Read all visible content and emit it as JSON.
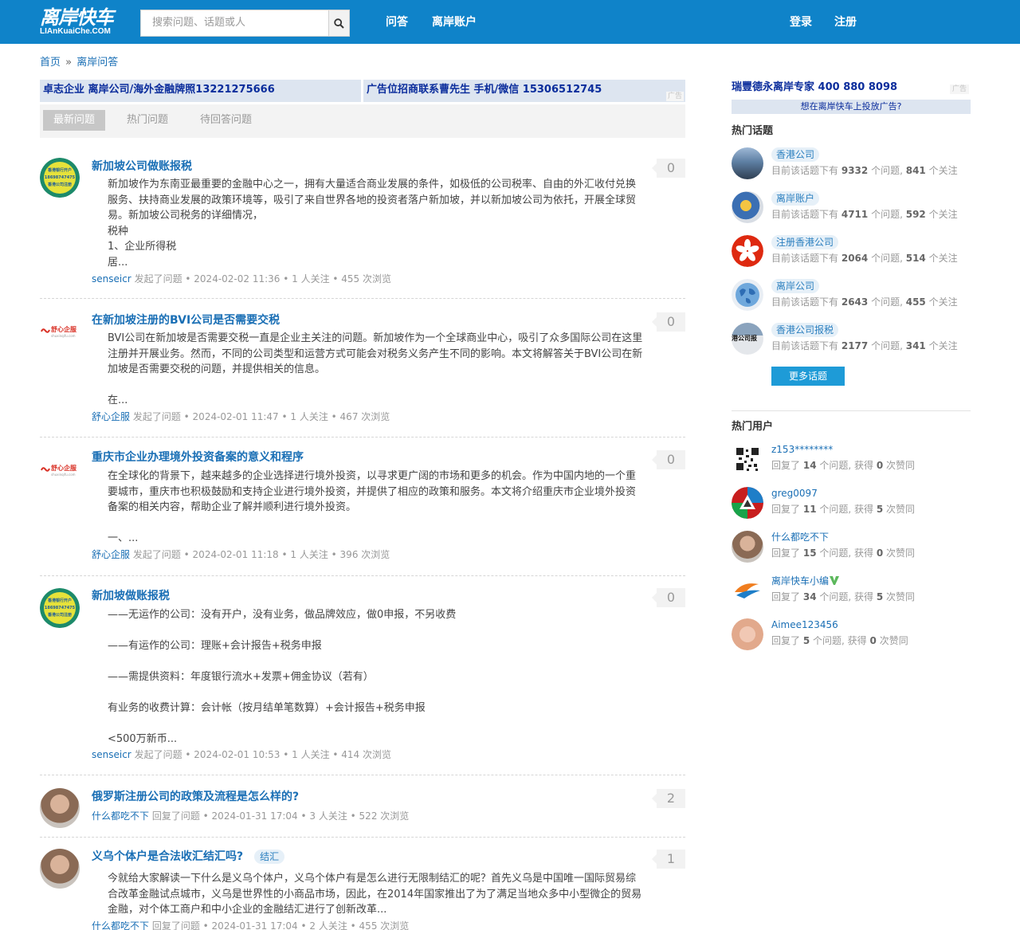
{
  "header": {
    "logo_cn": "离岸快车",
    "logo_en": "LIAnKuaiChe.COM",
    "search_placeholder": "搜索问题、话题或人",
    "nav": [
      "问答",
      "离岸账户"
    ],
    "login": "登录",
    "register": "注册"
  },
  "breadcrumb": {
    "home": "首页",
    "sep": "»",
    "current": "离岸问答"
  },
  "ads": {
    "left": "卓志企业 离岸公司/海外金融牌照13221275666",
    "right": "广告位招商联系曹先生 手机/微信 15306512745",
    "tag": "广告"
  },
  "tabs": [
    "最新问题",
    "热门问题",
    "待回答问题"
  ],
  "questions": [
    {
      "title": "新加坡公司做账报税",
      "count": "0",
      "body": "新加坡作为东南亚最重要的金融中心之一，拥有大量适合商业发展的条件，如极低的公司税率、自由的外汇收付兑换服务、扶持商业发展的政策环境等，吸引了来自世界各地的投资者落户新加坡，并以新加坡公司为依托，开展全球贸易。新加坡公司税务的详细情况，\n税种\n1、企业所得税\n居...",
      "user": "senseicr",
      "meta": "发起了问题 • 2024-02-02 11:36 • 1 人关注 • 455 次浏览"
    },
    {
      "title": "在新加坡注册的BVI公司是否需要交税",
      "count": "0",
      "body": "BVI公司在新加坡是否需要交税一直是企业主关注的问题。新加坡作为一个全球商业中心，吸引了众多国际公司在这里注册并开展业务。然而，不同的公司类型和运营方式可能会对税务义务产生不同的影响。本文将解答关于BVI公司在新加坡是否需要交税的问题，并提供相关的信息。\n\n在...",
      "user": "舒心企服",
      "meta": "发起了问题 • 2024-02-01 11:47 • 1 人关注 • 467 次浏览"
    },
    {
      "title": "重庆市企业办理境外投资备案的意义和程序",
      "count": "0",
      "body": "在全球化的背景下，越来越多的企业选择进行境外投资，以寻求更广阔的市场和更多的机会。作为中国内地的一个重要城市，重庆市也积极鼓励和支持企业进行境外投资，并提供了相应的政策和服务。本文将介绍重庆市企业境外投资备案的相关内容，帮助企业了解并顺利进行境外投资。\n\n一、...",
      "user": "舒心企服",
      "meta": "发起了问题 • 2024-02-01 11:18 • 1 人关注 • 396 次浏览"
    },
    {
      "title": "新加坡做账报税",
      "count": "0",
      "body": "——无运作的公司：没有开户，没有业务，做品牌效应，做0申报，不另收费\n\n——有运作的公司：理账+会计报告+税务申报\n\n——需提供资料：年度银行流水+发票+佣金协议（若有）\n\n有业务的收费计算：会计帐（按月结单笔数算）+会计报告+税务申报\n\n<500万新币...",
      "user": "senseicr",
      "meta": "发起了问题 • 2024-02-01 10:53 • 1 人关注 • 414 次浏览"
    },
    {
      "title": "俄罗斯注册公司的政策及流程是怎么样的?",
      "count": "2",
      "body": "",
      "user": "什么都吃不下",
      "meta": "回复了问题 • 2024-01-31 17:04 • 3 人关注 • 522 次浏览"
    },
    {
      "title": "义乌个体户是合法收汇结汇吗?",
      "tag": "结汇",
      "count": "1",
      "body": "今就给大家解读一下什么是义乌个体户，义乌个体户有是怎么进行无限制结汇的呢？首先义乌是中国唯一国际贸易综合改革金融试点城市，义乌是世界性的小商品市场，因此，在2014年国家推出了为了满足当地众多中小型微企的贸易金融，对个体工商户和中小企业的金融结汇进行了创新改革...",
      "user": "什么都吃不下",
      "meta": "回复了问题 • 2024-01-31 17:04 • 2 人关注 • 455 次浏览"
    }
  ],
  "avatar_text": {
    "qr_lines": [
      "香港银行开户",
      "18698747475",
      "香港公司注册"
    ],
    "shuxin_cn": "舒心企服",
    "shuxin_en": "shuxinqifu.com",
    "gangsi": "港公司报"
  },
  "sidebar": {
    "ad_title": "瑞豐德永离岸专家 400 880 8098",
    "ad_tag": "广告",
    "ad_link": "想在离岸快车上投放广告?",
    "hot_topics_title": "热门话题",
    "topics": [
      {
        "name": "香港公司",
        "prefix": "目前该话题下有",
        "questions": "9332",
        "mid": "个问题,",
        "follows": "841",
        "suffix": "个关注"
      },
      {
        "name": "离岸账户",
        "prefix": "目前该话题下有",
        "questions": "4711",
        "mid": "个问题,",
        "follows": "592",
        "suffix": "个关注"
      },
      {
        "name": "注册香港公司",
        "prefix": "目前该话题下有",
        "questions": "2064",
        "mid": "个问题,",
        "follows": "514",
        "suffix": "个关注"
      },
      {
        "name": "离岸公司",
        "prefix": "目前该话题下有",
        "questions": "2643",
        "mid": "个问题,",
        "follows": "455",
        "suffix": "个关注"
      },
      {
        "name": "香港公司报税",
        "prefix": "目前该话题下有",
        "questions": "2177",
        "mid": "个问题,",
        "follows": "341",
        "suffix": "个关注"
      }
    ],
    "more_topics": "更多话题",
    "hot_users_title": "热门用户",
    "users": [
      {
        "name": "z153********",
        "prefix": "回复了",
        "answers": "14",
        "mid": "个问题, 获得",
        "likes": "0",
        "suffix": "次赞同"
      },
      {
        "name": "greg0097",
        "prefix": "回复了",
        "answers": "11",
        "mid": "个问题, 获得",
        "likes": "5",
        "suffix": "次赞同"
      },
      {
        "name": "什么都吃不下",
        "prefix": "回复了",
        "answers": "15",
        "mid": "个问题, 获得",
        "likes": "0",
        "suffix": "次赞同"
      },
      {
        "name": "离岸快车小编",
        "prefix": "回复了",
        "answers": "34",
        "mid": "个问题, 获得",
        "likes": "5",
        "suffix": "次赞同"
      },
      {
        "name": "Aimee123456",
        "prefix": "回复了",
        "answers": "5",
        "mid": "个问题, 获得",
        "likes": "0",
        "suffix": "次赞同"
      }
    ]
  },
  "colors": {
    "header_bg": "#0f83c9",
    "link": "#1a6fb5",
    "ad_text": "#0b2d9c",
    "ad_bg": "#dde5f0",
    "button": "#1e9bd7",
    "verified": "#5cb85c"
  }
}
